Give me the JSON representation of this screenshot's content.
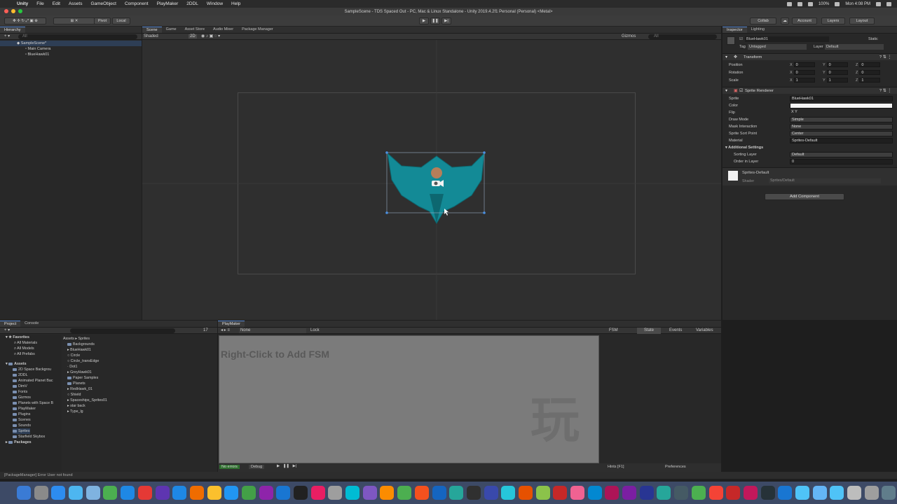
{
  "menubar": {
    "app": "Unity",
    "items": [
      "File",
      "Edit",
      "Assets",
      "GameObject",
      "Component",
      "PlayMaker",
      "2DDL",
      "Window",
      "Help"
    ],
    "battery": "100%",
    "clock": "Mon 4:08 PM"
  },
  "window": {
    "title": "SampleScene - TDS Spaced Out - PC, Mac & Linux Standalone - Unity 2019.4.2f1 Personal (Personal) <Metal>"
  },
  "toolbar": {
    "pivot": "Pivot",
    "local": "Local",
    "collab": "Collab",
    "account": "Account",
    "layers": "Layers",
    "layout": "Layout"
  },
  "hierarchy": {
    "tab": "Hierarchy",
    "search_placeholder": "All",
    "scene": "SampleScene*",
    "items": [
      "Main Camera",
      "BlueHawk01"
    ]
  },
  "scene_tabs": [
    "Scene",
    "Game",
    "Asset Store",
    "Audio Mixer",
    "Package Manager"
  ],
  "scene_toolbar": {
    "shading": "Shaded",
    "mode2d": "2D",
    "gizmos": "Gizmos",
    "search": "All"
  },
  "inspector": {
    "tabs": [
      "Inspector",
      "Lighting"
    ],
    "object_name": "BlueHawk01",
    "static": "Static",
    "tag_label": "Tag",
    "tag": "Untagged",
    "layer_label": "Layer",
    "layer": "Default",
    "transform": {
      "title": "Transform",
      "position": {
        "label": "Position",
        "x": "0",
        "y": "0",
        "z": "0"
      },
      "rotation": {
        "label": "Rotation",
        "x": "0",
        "y": "0",
        "z": "0"
      },
      "scale": {
        "label": "Scale",
        "x": "1",
        "y": "1",
        "z": "1"
      }
    },
    "sprite_renderer": {
      "title": "Sprite Renderer",
      "rows": [
        {
          "label": "Sprite",
          "value": "BlueHawk01"
        },
        {
          "label": "Color",
          "value": ""
        },
        {
          "label": "Flip",
          "value": "X  Y"
        },
        {
          "label": "Draw Mode",
          "value": "Simple"
        },
        {
          "label": "Mask Interaction",
          "value": "None"
        },
        {
          "label": "Sprite Sort Point",
          "value": "Center"
        },
        {
          "label": "Material",
          "value": "Sprites-Default"
        }
      ],
      "additional": "Additional Settings",
      "sorting_layer_label": "Sorting Layer",
      "sorting_layer": "Default",
      "order_label": "Order in Layer",
      "order": "0"
    },
    "material": {
      "name": "Sprites-Default",
      "shader_label": "Shader",
      "shader": "Sprites/Default"
    },
    "add_component": "Add Component"
  },
  "project": {
    "tabs": [
      "Project",
      "Console"
    ],
    "favorites_label": "Favorites",
    "favorites": [
      "All Materials",
      "All Models",
      "All Prefabs"
    ],
    "assets_label": "Assets",
    "asset_folders": [
      "2D Space Backgrou",
      "2DDL",
      "Animated Planet Bac",
      "DimV",
      "Fonts",
      "Gizmos",
      "Planets with Space B",
      "PlayMaker",
      "Plugins",
      "Scenes",
      "Sounds",
      "Sprites",
      "Starfield Skybox"
    ],
    "packages_label": "Packages",
    "breadcrumb": [
      "Assets",
      "Sprites"
    ],
    "sprites": [
      "Backgrounds",
      "BlueHawk01",
      "Circle",
      "Circle_transEdge",
      "Dot1",
      "GreyHawk01",
      "Paper Samples",
      "Planets",
      "RedHawk_01",
      "Shield",
      "Spaceships_Sprites01",
      "star back",
      "Type_lg"
    ],
    "count": "17"
  },
  "playmaker": {
    "tab": "PlayMaker",
    "selector": "None",
    "lock": "Lock",
    "hint": "Right-Click to Add FSM",
    "side_tabs": [
      "FSM",
      "State",
      "Events",
      "Variables"
    ],
    "status_errors": "No errors",
    "debug": "Debug",
    "hints": "Hints [F1]",
    "preferences": "Preferences",
    "watermark": "玩"
  },
  "statusbar": {
    "text": "[PackageManager] Error User not found"
  },
  "colors": {
    "ship": "#138a96",
    "ship_dark": "#0d6770",
    "engine": "#e07a4a",
    "accent": "#5a8bd6"
  },
  "dock_colors": [
    "#3a7bd5",
    "#8a8a8a",
    "#2d8cf0",
    "#4db6f0",
    "#7fb3e0",
    "#4caf50",
    "#1e88e5",
    "#e53935",
    "#5e35b1",
    "#1e88e5",
    "#ef6c00",
    "#fbc02d",
    "#2196f3",
    "#43a047",
    "#8e24aa",
    "#1976d2",
    "#212121",
    "#e91e63",
    "#9e9e9e",
    "#00bcd4",
    "#7e57c2",
    "#fb8c00",
    "#4caf50",
    "#f4511e",
    "#1565c0",
    "#26a69a",
    "#303030",
    "#3949ab",
    "#26c6da",
    "#e65100",
    "#8bc34a",
    "#c62828",
    "#f06292",
    "#0288d1",
    "#ad1457",
    "#7b1fa2",
    "#283593",
    "#26a69a",
    "#455a64",
    "#4caf50",
    "#f44336",
    "#c62828",
    "#c2185b",
    "#263238",
    "#1976d2",
    "#4fc3f7",
    "#64b5f6",
    "#4fc3f7",
    "#bdbdbd",
    "#9e9e9e",
    "#607d8b"
  ]
}
